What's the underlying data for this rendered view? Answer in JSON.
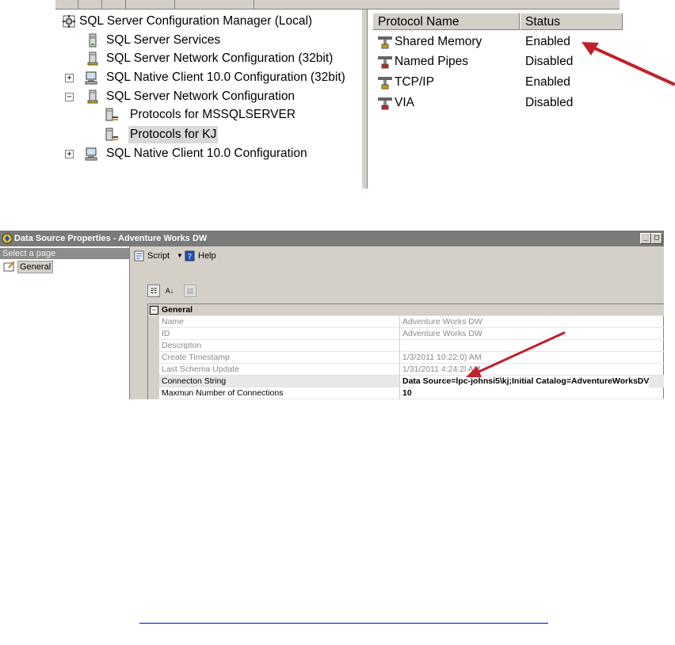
{
  "scm": {
    "tree": [
      {
        "label": "SQL Server Configuration Manager (Local)",
        "icon": "config-manager-icon"
      },
      {
        "label": "SQL Server Services",
        "icon": "server-icon"
      },
      {
        "label": "SQL Server Network Configuration (32bit)",
        "icon": "network-config-icon"
      },
      {
        "label": "SQL Native Client 10.0 Configuration (32bit)",
        "icon": "computer-icon",
        "expander": "+"
      },
      {
        "label": "SQL Server Network Configuration",
        "icon": "network-config-icon",
        "expander": "−"
      },
      {
        "label": "Protocols for MSSQLSERVER",
        "icon": "protocols-icon"
      },
      {
        "label": "Protocols for KJ",
        "icon": "protocols-icon",
        "selected": true
      },
      {
        "label": "SQL Native Client 10.0 Configuration",
        "icon": "computer-icon",
        "expander": "+"
      }
    ],
    "list": {
      "columns": [
        "Protocol Name",
        "Status"
      ],
      "rows": [
        {
          "name": "Shared Memory",
          "status": "Enabled",
          "icon": "plug-icon"
        },
        {
          "name": "Named Pipes",
          "status": "Disabled",
          "icon": "plug-icon"
        },
        {
          "name": "TCP/IP",
          "status": "Enabled",
          "icon": "plug-icon"
        },
        {
          "name": "VIA",
          "status": "Disabled",
          "icon": "plug-icon"
        }
      ]
    }
  },
  "dsp": {
    "title": "Data Source Properties - Adventure Works DW",
    "select_page": "Select a page",
    "page_general": "General",
    "script_label": "Script",
    "help_label": "Help",
    "category": "General",
    "properties": [
      {
        "name": "Name",
        "value": "Adventure Works DW"
      },
      {
        "name": "ID",
        "value": "Adventure Works DW"
      },
      {
        "name": "Descripton",
        "value": ""
      },
      {
        "name": "Create Timestamp",
        "value": "1/3/2011 10:22:0) AM"
      },
      {
        "name": "Last Schema Update",
        "value": "1/31/2011 4:24:2l AM"
      },
      {
        "name": "Connecton String",
        "value": "Data Source=lpc-johnsi5\\kj;Initial Catalog=AdventureWorksDV"
      },
      {
        "name": "Maxmun Number of Connections",
        "value": "10"
      }
    ]
  },
  "colors": {
    "arrow": "#c0202a",
    "link": "#0000ff"
  }
}
